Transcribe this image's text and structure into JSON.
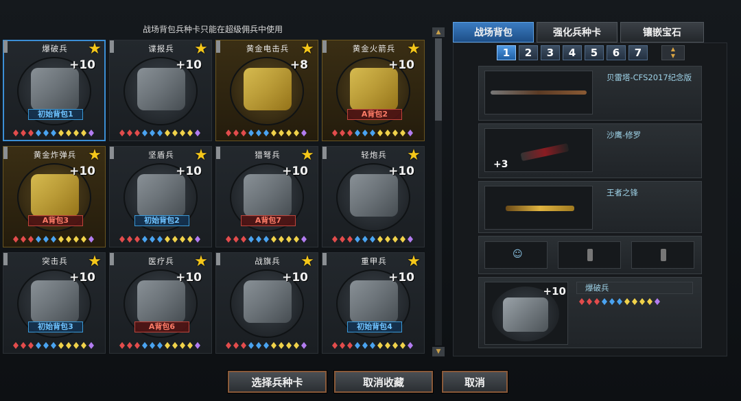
{
  "notice": "战场背包兵种卡只能在超级佣兵中使用",
  "cards": [
    {
      "name": "爆破兵",
      "plus": "+10",
      "badge": "初始背包1",
      "badge_color": "blue",
      "gold": false,
      "selected": true
    },
    {
      "name": "谍报兵",
      "plus": "+10",
      "badge": "",
      "badge_color": "",
      "gold": false,
      "selected": false
    },
    {
      "name": "黄金电击兵",
      "plus": "+8",
      "badge": "",
      "badge_color": "",
      "gold": true,
      "selected": false
    },
    {
      "name": "黄金火箭兵",
      "plus": "+10",
      "badge": "A背包2",
      "badge_color": "red",
      "gold": true,
      "selected": false
    },
    {
      "name": "黄金炸弹兵",
      "plus": "+10",
      "badge": "A背包3",
      "badge_color": "red",
      "gold": true,
      "selected": false
    },
    {
      "name": "坚盾兵",
      "plus": "+10",
      "badge": "初始背包2",
      "badge_color": "blue",
      "gold": false,
      "selected": false
    },
    {
      "name": "猎弩兵",
      "plus": "+10",
      "badge": "A背包7",
      "badge_color": "red",
      "gold": false,
      "selected": false
    },
    {
      "name": "轻炮兵",
      "plus": "+10",
      "badge": "",
      "badge_color": "",
      "gold": false,
      "selected": false
    },
    {
      "name": "突击兵",
      "plus": "+10",
      "badge": "初始背包3",
      "badge_color": "blue",
      "gold": false,
      "selected": false
    },
    {
      "name": "医疗兵",
      "plus": "+10",
      "badge": "A背包6",
      "badge_color": "red",
      "gold": false,
      "selected": false
    },
    {
      "name": "战旗兵",
      "plus": "+10",
      "badge": "",
      "badge_color": "",
      "gold": false,
      "selected": false
    },
    {
      "name": "重甲兵",
      "plus": "+10",
      "badge": "初始背包4",
      "badge_color": "blue",
      "gold": false,
      "selected": false
    }
  ],
  "tabs": [
    "战场背包",
    "强化兵种卡",
    "镶嵌宝石"
  ],
  "pages": [
    "1",
    "2",
    "3",
    "4",
    "5",
    "6",
    "7"
  ],
  "current_page": "1",
  "slots": [
    {
      "label": "贝雷塔-CFS2017纪念版",
      "extra": ""
    },
    {
      "label": "沙鹰-修罗",
      "extra": "+3"
    },
    {
      "label": "王者之锋",
      "extra": ""
    }
  ],
  "selected_card": {
    "name": "爆破兵",
    "plus": "+10"
  },
  "buttons": {
    "select": "选择兵种卡",
    "cancel_fav": "取消收藏",
    "cancel": "取消"
  },
  "colors": {
    "star": "#f5c71a",
    "active_tab": "#3b7cc1",
    "badge_blue": "#6fc3ff",
    "badge_red": "#ff7d68"
  }
}
